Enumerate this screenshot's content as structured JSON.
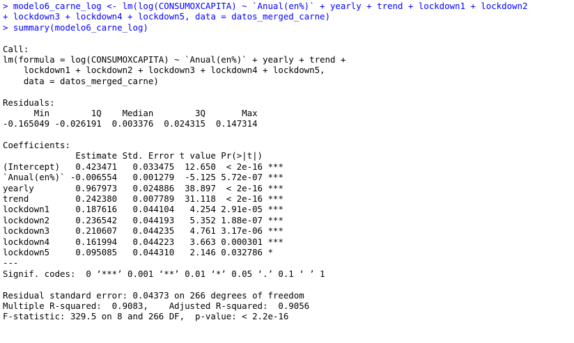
{
  "console": {
    "input_lines": [
      "> modelo6_carne_log <- lm(log(CONSUMOXCAPITA) ~ `Anual(en%)` + yearly + trend + lockdown1 + lockdown2",
      "+ lockdown3 + lockdown4 + lockdown5, data = datos_merged_carne)",
      "> summary(modelo6_carne_log)"
    ],
    "call": {
      "header": "Call:",
      "lines": [
        "lm(formula = log(CONSUMOXCAPITA) ~ `Anual(en%)` + yearly + trend +",
        "    lockdown1 + lockdown2 + lockdown3 + lockdown4 + lockdown5,",
        "    data = datos_merged_carne)"
      ]
    },
    "residuals": {
      "header": "Residuals:",
      "labels_line": "      Min        1Q    Median        3Q       Max ",
      "values_line": "-0.165049 -0.026191  0.003376  0.024315  0.147314 "
    },
    "coefficients": {
      "header": "Coefficients:",
      "column_header": "              Estimate Std. Error t value Pr(>|t|)    ",
      "rows": [
        "(Intercept)   0.423471   0.033475  12.650  < 2e-16 ***",
        "`Anual(en%)` -0.006554   0.001279  -5.125 5.72e-07 ***",
        "yearly        0.967973   0.024886  38.897  < 2e-16 ***",
        "trend         0.242380   0.007789  31.118  < 2e-16 ***",
        "lockdown1     0.187616   0.044104   4.254 2.91e-05 ***",
        "lockdown2     0.236542   0.044193   5.352 1.88e-07 ***",
        "lockdown3     0.210607   0.044235   4.761 3.17e-06 ***",
        "lockdown4     0.161994   0.044223   3.663 0.000301 ***",
        "lockdown5     0.095085   0.044310   2.146 0.032786 *  "
      ],
      "separator": "---",
      "signif_codes": "Signif. codes:  0 ‘***’ 0.001 ‘**’ 0.01 ‘*’ 0.05 ‘.’ 0.1 ‘ ’ 1"
    },
    "footer": [
      "Residual standard error: 0.04373 on 266 degrees of freedom",
      "Multiple R-squared:  0.9083,\tAdjusted R-squared:  0.9056 ",
      "F-statistic: 329.5 on 8 and 266 DF,  p-value: < 2.2e-16"
    ]
  },
  "colors": {
    "input": "#0000ff",
    "output": "#000000",
    "background": "#ffffff"
  }
}
